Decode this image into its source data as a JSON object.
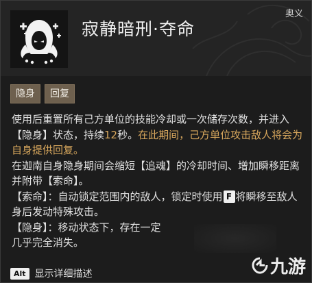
{
  "skill": {
    "title": "寂静暗刑·夺命",
    "type": "奥义",
    "icon": "hooded-assassin-icon"
  },
  "tags": [
    "隐身",
    "回复"
  ],
  "description": {
    "p1_a": "使用后重置所有己方单位的技能冷却或一次储存次数，并进入【隐身】状态，持续",
    "p1_duration": "12",
    "p1_b": "秒。",
    "p1_highlight": "在此期间，己方单位攻击敌人将会为自身提供回复。",
    "p2": "在迦南自身隐身期间会缩短【追魂】的冷却时间、增加瞬移距离并附带【索命】。",
    "p3_a": "【索命】：自动锁定范围内的敌人，锁定时使用",
    "p3_key": "F",
    "p3_b": "将瞬移至敌人身后发动特殊攻击。",
    "p4": "【隐身】：移动状态下，存在一定",
    "p5": "几乎完全消失。"
  },
  "footer": {
    "key": "Alt",
    "label": "显示详细描述"
  },
  "watermark": {
    "text": "九游"
  },
  "colors": {
    "highlight": "#d9a85d",
    "tag_bg": "#6e604e",
    "panel_bg": "#1c1c1c"
  }
}
